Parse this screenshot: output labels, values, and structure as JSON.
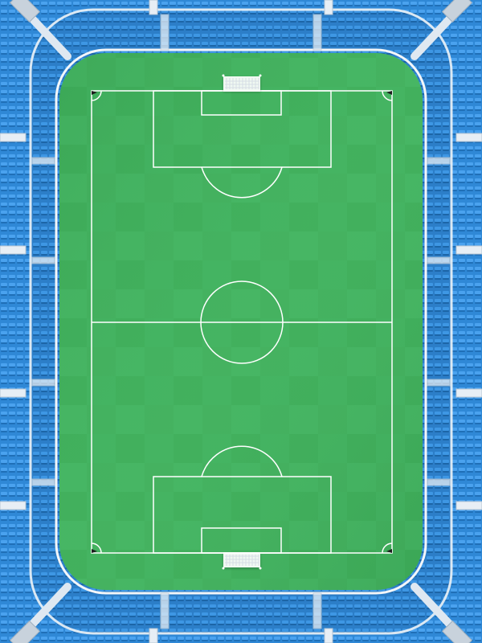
{
  "scene": {
    "kind": "stadium-top-down-illustration",
    "labels": []
  },
  "colors": {
    "seat_blue": "#2f88d6",
    "seat_light": "#69b6ff",
    "stand_outline": "#f1f1f1",
    "pitch_green": "#3eaf5a",
    "pitch_stripe": "#4dbd68",
    "line_white": "#ffffff",
    "post_gray": "#c8d2dc"
  },
  "icons": [
    "goal-net-icon",
    "floodlight-pole-icon",
    "stair-aisle-icon"
  ]
}
